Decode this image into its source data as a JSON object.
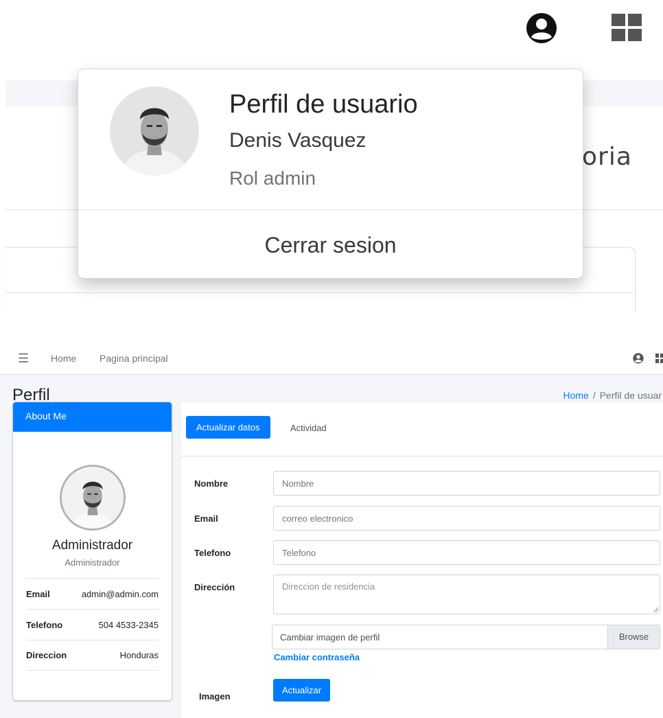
{
  "zoom": {
    "dropdown": {
      "title": "Perfil de usuario",
      "name": "Denis Vasquez",
      "role": "Rol admin",
      "logout": "Cerrar sesion"
    },
    "background_fragment": "oria"
  },
  "navbar": {
    "home": "Home",
    "main": "Pagina principal"
  },
  "page": {
    "title": "Perfil",
    "breadcrumb_home": "Home",
    "breadcrumb_sep": "/",
    "breadcrumb_current": "Perfil de usuar"
  },
  "about": {
    "header": "About Me",
    "name": "Administrador",
    "role": "Administrador",
    "rows": [
      {
        "key": "Email",
        "value": "admin@admin.com"
      },
      {
        "key": "Telefono",
        "value": "504 4533-2345"
      },
      {
        "key": "Direccion",
        "value": "Honduras"
      }
    ]
  },
  "tabs": {
    "active": "Actualizar datos",
    "other": "Actividad"
  },
  "form": {
    "nombre_label": "Nombre",
    "nombre_placeholder": "Nombre",
    "email_label": "Email",
    "email_placeholder": "correo electronico",
    "telefono_label": "Telefono",
    "telefono_placeholder": "Telefono",
    "direccion_label": "Dirección",
    "direccion_placeholder": "Direccion de residencia",
    "imagen_label": "Imagen",
    "file_text": "Cambiar imagen de perfil",
    "browse": "Browse",
    "change_password": "Cambiar contraseña",
    "submit": "Actualizar"
  },
  "colors": {
    "primary": "#007bff",
    "background": "#f4f6f9"
  },
  "icons": [
    "user-circle-icon",
    "apps-grid-icon",
    "hamburger-menu-icon"
  ]
}
